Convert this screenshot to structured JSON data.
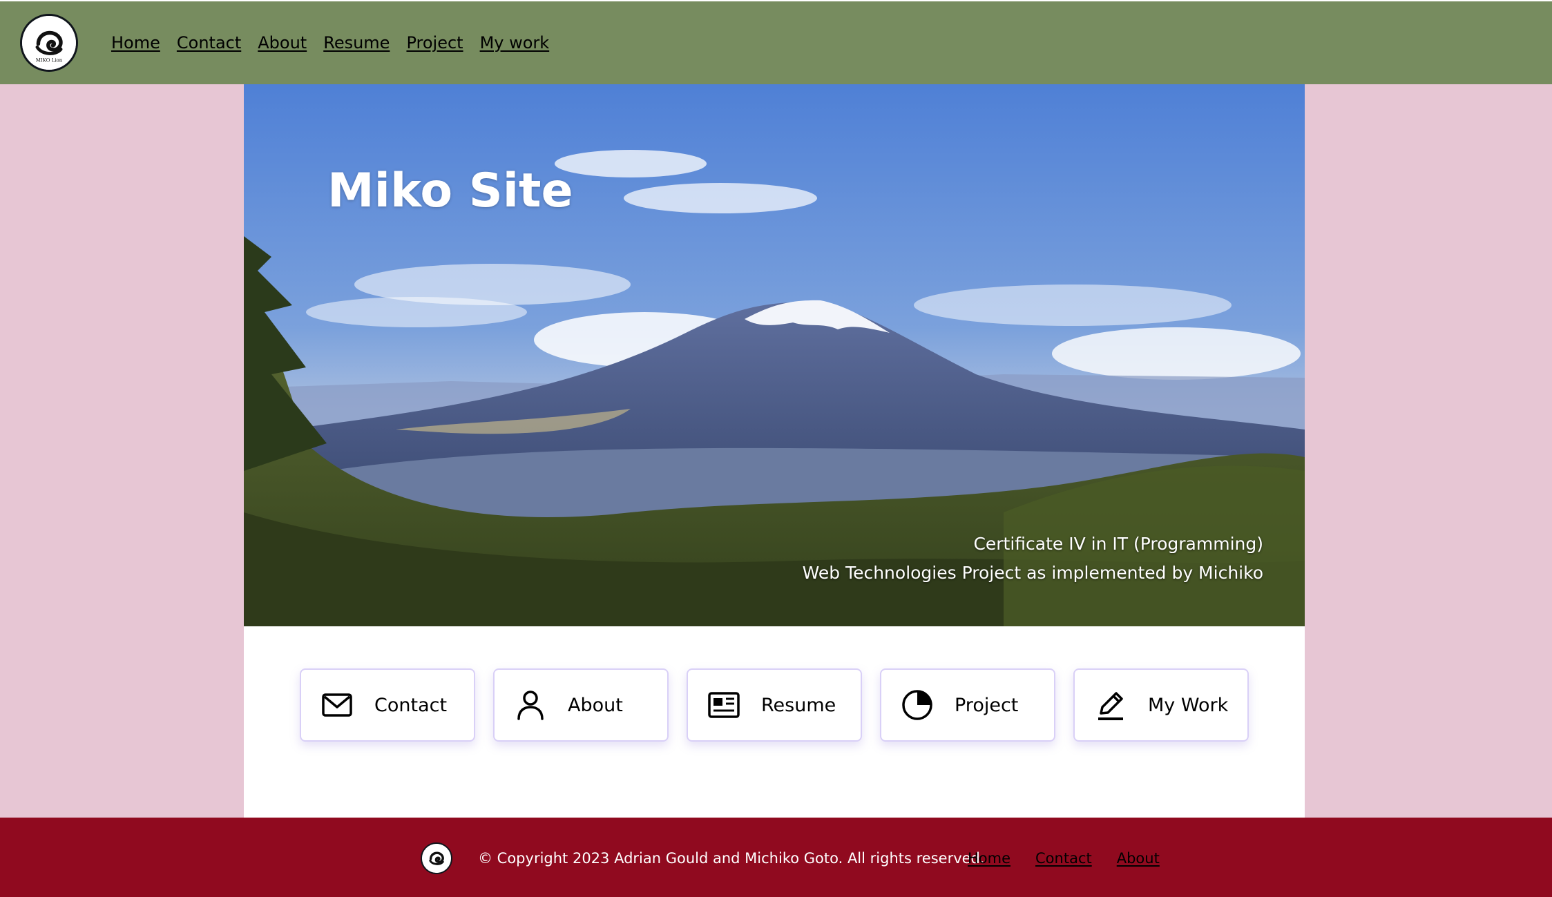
{
  "colors": {
    "page_background": "#e7c6d4",
    "header_background": "#778c5f",
    "footer_background": "#900a1f",
    "card_border": "#d9d0f7"
  },
  "header": {
    "logo_text": "MIKO Lion",
    "nav": [
      {
        "label": "Home"
      },
      {
        "label": "Contact"
      },
      {
        "label": "About"
      },
      {
        "label": "Resume"
      },
      {
        "label": "Project"
      },
      {
        "label": "My work"
      }
    ]
  },
  "hero": {
    "title": "Miko Site",
    "subtitle_line1": "Certificate IV in IT (Programming)",
    "subtitle_line2": "Web Technologies Project as implemented by Michiko"
  },
  "cards": [
    {
      "label": "Contact",
      "icon": "envelope-icon"
    },
    {
      "label": "About",
      "icon": "user-icon"
    },
    {
      "label": "Resume",
      "icon": "newspaper-icon"
    },
    {
      "label": "Project",
      "icon": "pie-chart-icon"
    },
    {
      "label": "My Work",
      "icon": "pencil-icon"
    }
  ],
  "footer": {
    "copyright": "© Copyright 2023 Adrian Gould and Michiko Goto. All rights reserved.",
    "nav": [
      {
        "label": "Home"
      },
      {
        "label": "Contact"
      },
      {
        "label": "About"
      }
    ]
  }
}
